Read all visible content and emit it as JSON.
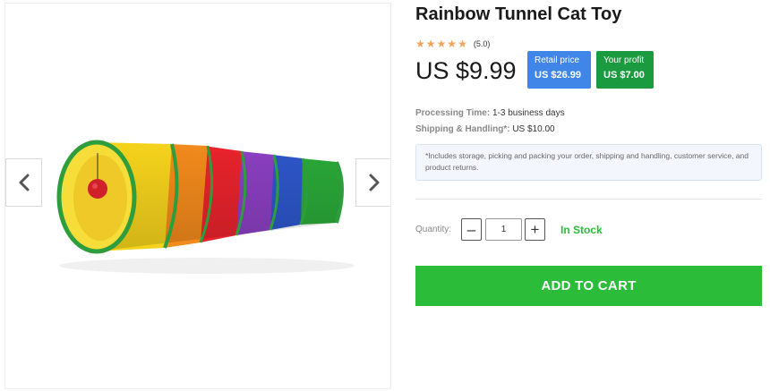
{
  "product": {
    "title": "Rainbow Tunnel Cat Toy",
    "rating": {
      "stars": 5,
      "text": "(5.0)"
    },
    "price": "US $9.99",
    "retail": {
      "label": "Retail price",
      "value": "US $26.99"
    },
    "profit": {
      "label": "Your profit",
      "value": "US $7.00"
    },
    "processing": {
      "label": "Processing Time:",
      "value": "1-3 business days"
    },
    "shipping": {
      "label": "Shipping & Handling*:",
      "value": "US $10.00"
    },
    "note": "*Includes storage, picking and packing your order, shipping and handling, customer service, and product returns."
  },
  "quantity": {
    "label": "Quantity:",
    "value": "1",
    "minus": "–",
    "plus": "+"
  },
  "stock_status": "In Stock",
  "add_to_cart_label": "ADD TO CART",
  "colors": {
    "accent_green": "#2bbd3a",
    "retail_blue": "#3f86e8",
    "profit_green": "#1c9a40",
    "star": "#f3a45b"
  }
}
